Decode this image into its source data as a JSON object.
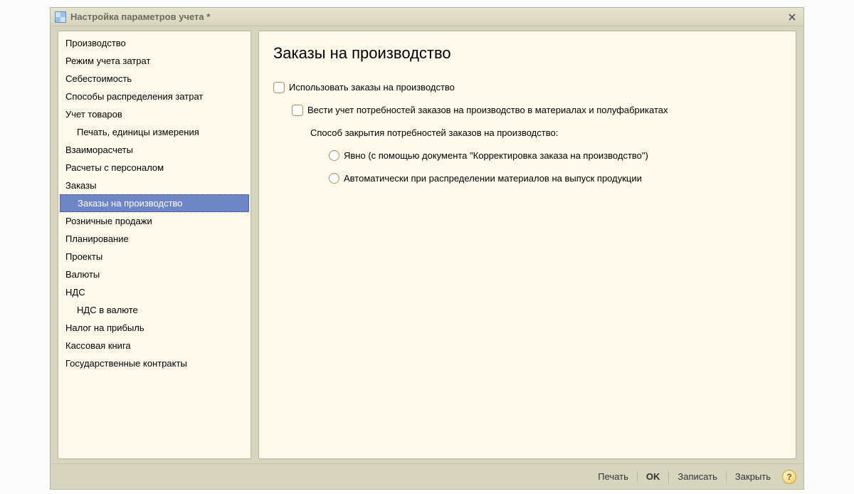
{
  "titlebar": {
    "title": "Настройка параметров учета *"
  },
  "sidebar": {
    "items": [
      {
        "label": "Производство",
        "indent": 0
      },
      {
        "label": "Режим учета затрат",
        "indent": 0
      },
      {
        "label": "Себестоимость",
        "indent": 0
      },
      {
        "label": "Способы распределения затрат",
        "indent": 0
      },
      {
        "label": "Учет товаров",
        "indent": 0
      },
      {
        "label": "Печать, единицы измерения",
        "indent": 1
      },
      {
        "label": "Взаиморасчеты",
        "indent": 0
      },
      {
        "label": "Расчеты с персоналом",
        "indent": 0
      },
      {
        "label": "Заказы",
        "indent": 0
      },
      {
        "label": "Заказы на производство",
        "indent": 1,
        "selected": true
      },
      {
        "label": "Розничные продажи",
        "indent": 0
      },
      {
        "label": "Планирование",
        "indent": 0
      },
      {
        "label": "Проекты",
        "indent": 0
      },
      {
        "label": "Валюты",
        "indent": 0
      },
      {
        "label": "НДС",
        "indent": 0
      },
      {
        "label": "НДС в валюте",
        "indent": 1
      },
      {
        "label": "Налог на прибыль",
        "indent": 0
      },
      {
        "label": "Кассовая книга",
        "indent": 0
      },
      {
        "label": "Государственные контракты",
        "indent": 0
      }
    ]
  },
  "content": {
    "heading": "Заказы на производство",
    "opt1": "Использовать заказы на производство",
    "opt2": "Вести учет потребностей заказов на производство в материалах и полуфабрикатах",
    "group_label": "Способ закрытия потребностей заказов на производство:",
    "radio1": "Явно (с помощью документа \"Корректировка заказа на производство\")",
    "radio2": "Автоматически при распределении материалов на выпуск продукции"
  },
  "footer": {
    "print": "Печать",
    "ok": "OK",
    "write": "Записать",
    "close": "Закрыть",
    "help": "?"
  }
}
